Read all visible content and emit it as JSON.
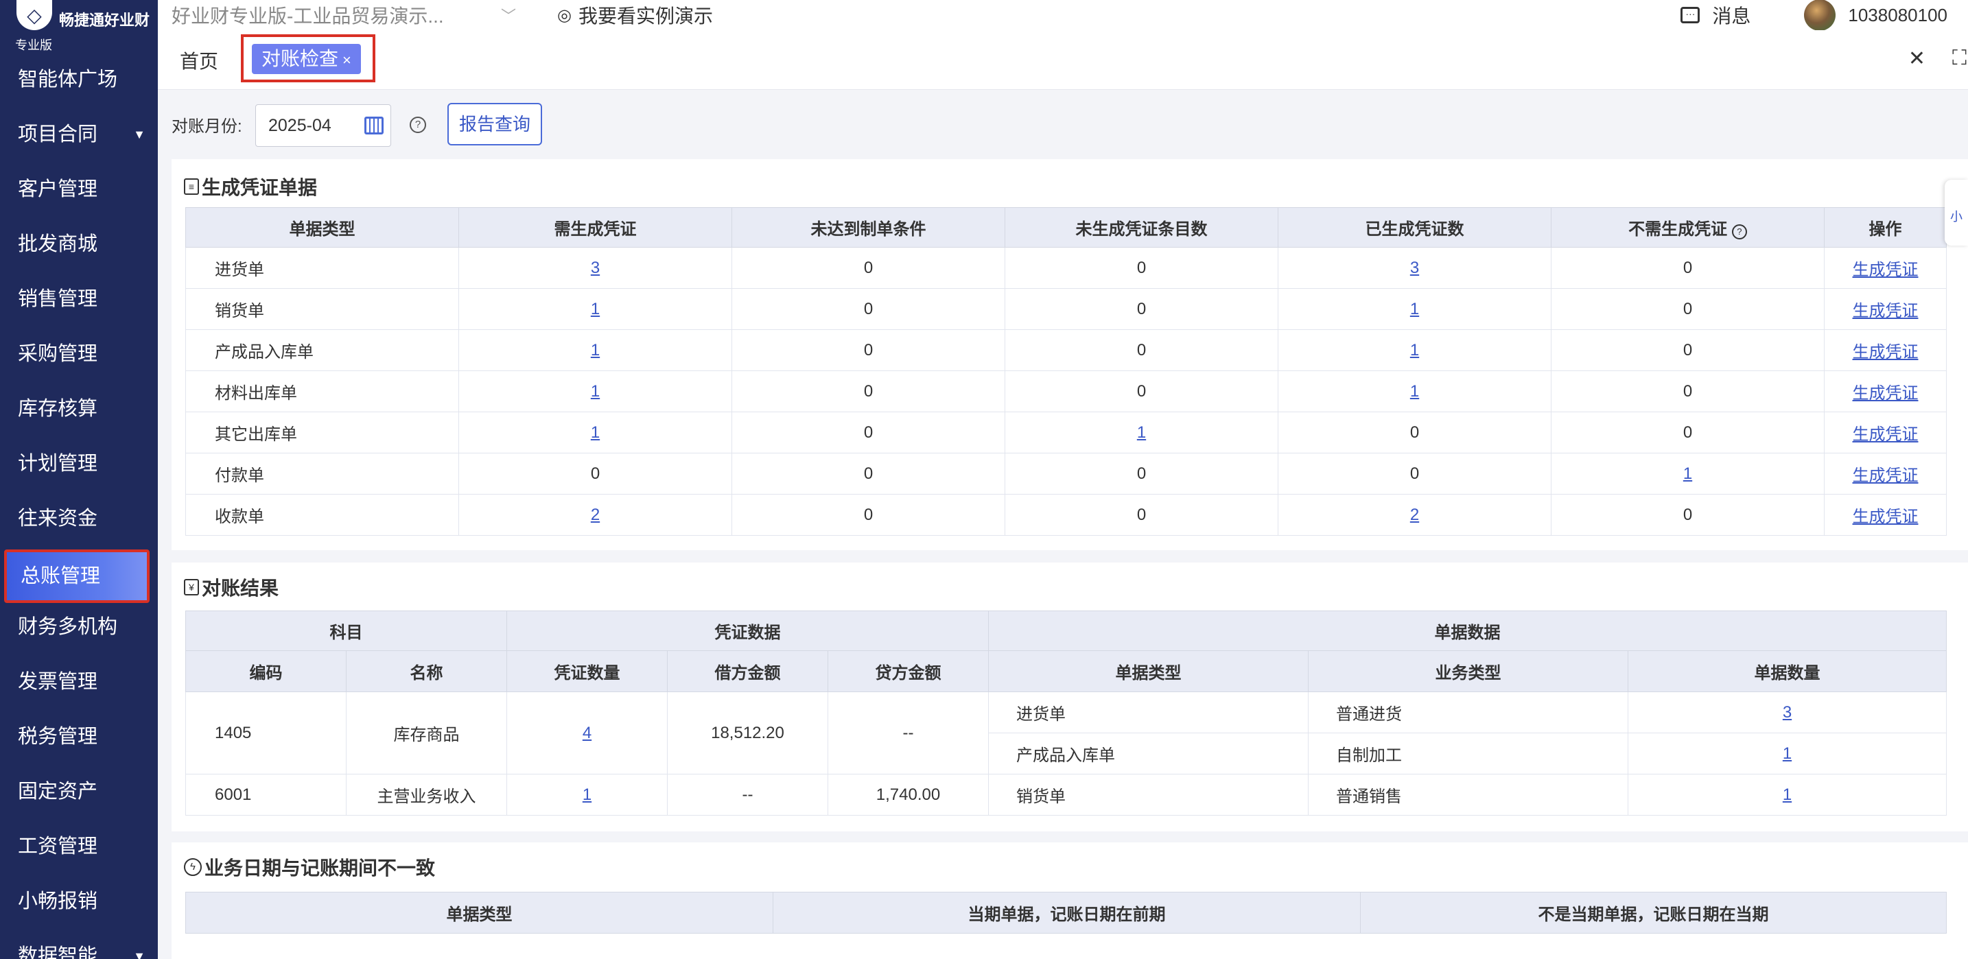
{
  "brand": {
    "name": "畅捷通好业财",
    "edition": "专业版",
    "logo_icon": "chanjet-logo-icon"
  },
  "sidebar": {
    "items": [
      {
        "label": "智能体广场"
      },
      {
        "label": "项目合同",
        "caret": "▼"
      },
      {
        "label": "客户管理"
      },
      {
        "label": "批发商城"
      },
      {
        "label": "销售管理"
      },
      {
        "label": "采购管理"
      },
      {
        "label": "库存核算"
      },
      {
        "label": "计划管理"
      },
      {
        "label": "往来资金"
      },
      {
        "label": "总账管理",
        "active": true
      },
      {
        "label": "财务多机构"
      },
      {
        "label": "发票管理"
      },
      {
        "label": "税务管理"
      },
      {
        "label": "固定资产"
      },
      {
        "label": "工资管理"
      },
      {
        "label": "小畅报销"
      },
      {
        "label": "数据智能",
        "caret": "▼"
      }
    ]
  },
  "topbar": {
    "company": "好业财专业版-工业品贸易演示...",
    "company_caret": "﹀",
    "demo_label": "我要看实例演示",
    "messages_label": "消息",
    "user_id": "1038080100"
  },
  "tabs": {
    "home": "首页",
    "active_label": "对账检查",
    "close_glyph": "×",
    "close_all_glyph": "✕",
    "fullscreen_glyph": "⛶"
  },
  "filter": {
    "month_label": "对账月份:",
    "month_value": "2025-04",
    "report_button": "报告查询"
  },
  "voucher_section": {
    "title": "生成凭证单据",
    "headers": [
      "单据类型",
      "需生成凭证",
      "未达到制单条件",
      "未生成凭证条目数",
      "已生成凭证数",
      "不需生成凭证",
      "操作"
    ],
    "help_glyph": "?",
    "rows": [
      {
        "type": "进货单",
        "need": "3",
        "unmet": "0",
        "not_generated": "0",
        "generated": "3",
        "no_need": "0",
        "action": "生成凭证"
      },
      {
        "type": "销货单",
        "need": "1",
        "unmet": "0",
        "not_generated": "0",
        "generated": "1",
        "no_need": "0",
        "action": "生成凭证"
      },
      {
        "type": "产成品入库单",
        "need": "1",
        "unmet": "0",
        "not_generated": "0",
        "generated": "1",
        "no_need": "0",
        "action": "生成凭证"
      },
      {
        "type": "材料出库单",
        "need": "1",
        "unmet": "0",
        "not_generated": "0",
        "generated": "1",
        "no_need": "0",
        "action": "生成凭证"
      },
      {
        "type": "其它出库单",
        "need": "1",
        "unmet": "0",
        "not_generated": "1",
        "generated": "0",
        "no_need": "0",
        "action": "生成凭证"
      },
      {
        "type": "付款单",
        "need": "0",
        "unmet": "0",
        "not_generated": "0",
        "generated": "0",
        "no_need": "1",
        "action": "生成凭证"
      },
      {
        "type": "收款单",
        "need": "2",
        "unmet": "0",
        "not_generated": "0",
        "generated": "2",
        "no_need": "0",
        "action": "生成凭证"
      }
    ]
  },
  "reconcile_section": {
    "title": "对账结果",
    "group_headers": {
      "subject": "科目",
      "voucher": "凭证数据",
      "document": "单据数据"
    },
    "headers": [
      "编码",
      "名称",
      "凭证数量",
      "借方金额",
      "贷方金额",
      "单据类型",
      "业务类型",
      "单据数量"
    ],
    "rows": [
      {
        "code": "1405",
        "name": "库存商品",
        "count": "4",
        "debit": "18,512.20",
        "credit": "--",
        "docs": [
          {
            "doc_type": "进货单",
            "biz_type": "普通进货",
            "doc_count": "3"
          },
          {
            "doc_type": "产成品入库单",
            "biz_type": "自制加工",
            "doc_count": "1"
          }
        ]
      },
      {
        "code": "6001",
        "name": "主营业务收入",
        "count": "1",
        "debit": "--",
        "credit": "1,740.00",
        "docs": [
          {
            "doc_type": "销货单",
            "biz_type": "普通销售",
            "doc_count": "1"
          }
        ]
      }
    ]
  },
  "period_section": {
    "title": "业务日期与记账期间不一致",
    "headers": [
      "单据类型",
      "当期单据，记账日期在前期",
      "不是当期单据，记账日期在当期"
    ]
  },
  "side_fab": {
    "label": "小"
  }
}
